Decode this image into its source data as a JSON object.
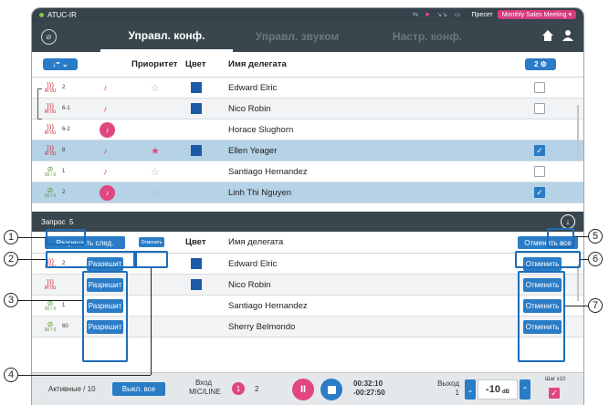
{
  "status": {
    "app": "ATUC-IR",
    "preset": "Пресет",
    "meeting": "Monthly Sales Meeting"
  },
  "tabs": {
    "conf": "Управл. конф.",
    "sound": "Управл. звуком",
    "settings": "Настр. конф."
  },
  "header": {
    "priority": "Приоритет",
    "color": "Цвет",
    "name": "Имя делегата",
    "count": "2"
  },
  "delegates": [
    {
      "num": "2",
      "name": "Edward Elric",
      "mic": "IR 0U"
    },
    {
      "num": "6-1",
      "name": "Nico Robin",
      "mic": "IR 0U"
    },
    {
      "num": "6-2",
      "name": "Horace Slughorn",
      "mic": "IR 0U"
    },
    {
      "num": "8",
      "name": "Ellen Yeager",
      "mic": "IR 0U"
    },
    {
      "num": "1",
      "name": "Santiago Hernandez",
      "mic": "00 / 0"
    },
    {
      "num": "2",
      "name": "Linh Thi Nguyen",
      "mic": "00 / 0"
    }
  ],
  "request": {
    "label": "Запрос",
    "count": "5",
    "allow_next": "Разрешить след.",
    "cancel_small": "Отменить",
    "color": "Цвет",
    "name": "Имя делегата",
    "cancel_all": "Отменить все",
    "allow": "Разрешит",
    "cancel": "Отменить",
    "rows": [
      {
        "num": "2",
        "name": "Edward Elric"
      },
      {
        "num": "",
        "name": "Nico Robin"
      },
      {
        "num": "1",
        "name": "Santiago Hernandez"
      },
      {
        "num": "60",
        "name": "Sherry Belmondo"
      }
    ]
  },
  "bottom": {
    "active": "Активные",
    "active_count": "/ 10",
    "off_all": "Выкл. все",
    "input": "Вход",
    "input_src": "MIC/LINE",
    "ch1": "1",
    "ch2": "2",
    "time_elapsed": "00:32:10",
    "time_left": "-00:27:50",
    "output": "Выход",
    "output_num": "1",
    "level": "-10",
    "unit": "dB",
    "step": "Шаг x10"
  },
  "callouts": [
    "1",
    "2",
    "3",
    "4",
    "5",
    "6",
    "7"
  ],
  "colors": {
    "accent": "#2a7cc7",
    "pink": "#e0467f",
    "dark": "#3a464e"
  }
}
